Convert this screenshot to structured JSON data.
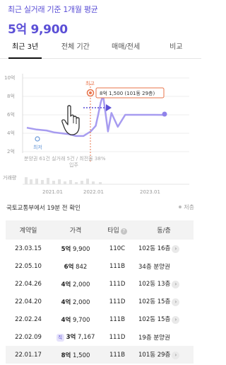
{
  "header": {
    "subtitle": "최근 실거래 기준 1개월 평균",
    "price": "5억 9,900"
  },
  "tabs": [
    {
      "label": "최근 3년",
      "active": true
    },
    {
      "label": "전체 기간",
      "active": false
    },
    {
      "label": "매매/전세",
      "active": false
    },
    {
      "label": "비교",
      "active": false
    }
  ],
  "chart": {
    "y_labels": [
      "10억",
      "8억",
      "6억",
      "4억",
      "2억"
    ],
    "x_labels": [
      "2021.01",
      "2022.01",
      "2023.01"
    ],
    "volume_label": "거래량",
    "max_marker_label": "최고",
    "min_marker_label": "최저",
    "tooltip": "8억 1,500 (101동 29층)",
    "footnote_a": "분양권 61건 실거래 5건 / 최전율 38%",
    "footnote_b": "입주",
    "colors": {
      "accent": "#5b4fd6",
      "line": "#a79cf0",
      "marker": "#e8734a"
    }
  },
  "chart_data": {
    "type": "line",
    "series": [
      {
        "values": [
          [
            2020.6,
            4.6
          ],
          [
            2020.8,
            4.4
          ],
          [
            2021.0,
            4.3
          ],
          [
            2021.15,
            4.1
          ],
          [
            2021.3,
            4.0
          ],
          [
            2021.45,
            3.9
          ],
          [
            2021.6,
            3.7
          ],
          [
            2021.75,
            3.7
          ],
          [
            2021.9,
            4.2
          ],
          [
            2022.0,
            4.8
          ],
          [
            2022.05,
            6.0
          ],
          [
            2022.1,
            7.3
          ],
          [
            2022.15,
            8.15
          ],
          [
            2022.25,
            4.2
          ],
          [
            2022.32,
            6.2
          ],
          [
            2022.45,
            4.7
          ],
          [
            2022.6,
            6.0
          ],
          [
            2022.8,
            6.0
          ],
          [
            2023.0,
            6.0
          ],
          [
            2023.2,
            6.0
          ],
          [
            2023.4,
            5.99
          ]
        ]
      }
    ],
    "ylim": [
      1,
      11
    ],
    "yticks": [
      "10억",
      "8억",
      "6억",
      "4억",
      "2억"
    ],
    "xticks": [
      "2021.01",
      "2022.01",
      "2023.01"
    ],
    "max_point": {
      "label": "최고",
      "value": "8억 1,500 (101동 29층)"
    },
    "min_point": {
      "label": "최저"
    }
  },
  "info": {
    "confirm_text": "국토교통부에서 19분 전 확인",
    "sort_label": "저층"
  },
  "table": {
    "headers": {
      "date": "계약일",
      "price": "가격",
      "type": "타입",
      "unit": "동/층"
    },
    "rows": [
      {
        "date": "23.03.15",
        "price_bold": "5억",
        "price_rest": "9,900",
        "type": "110C",
        "unit": "102동 16층",
        "badge": "",
        "chev": "›"
      },
      {
        "date": "22.05.10",
        "price_bold": "6억",
        "price_rest": "842",
        "type": "111B",
        "unit": "34층 분양권",
        "badge": "",
        "chev": ""
      },
      {
        "date": "22.04.26",
        "price_bold": "4억",
        "price_rest": "2,000",
        "type": "111D",
        "unit": "102동 13층",
        "badge": "",
        "chev": "›"
      },
      {
        "date": "22.04.20",
        "price_bold": "4억",
        "price_rest": "2,000",
        "type": "111D",
        "unit": "102동 15층",
        "badge": "",
        "chev": "›"
      },
      {
        "date": "22.02.24",
        "price_bold": "4억",
        "price_rest": "9,700",
        "type": "111B",
        "unit": "102동 15층",
        "badge": "",
        "chev": "›"
      },
      {
        "date": "22.02.09",
        "price_bold": "3억",
        "price_rest": "7,167",
        "type": "111D",
        "unit": "19층 분양권",
        "badge": "직",
        "chev": ""
      },
      {
        "date": "22.01.17",
        "price_bold": "8억",
        "price_rest": "1,500",
        "type": "111B",
        "unit": "101동 29층",
        "badge": "",
        "chev": "›"
      }
    ]
  }
}
